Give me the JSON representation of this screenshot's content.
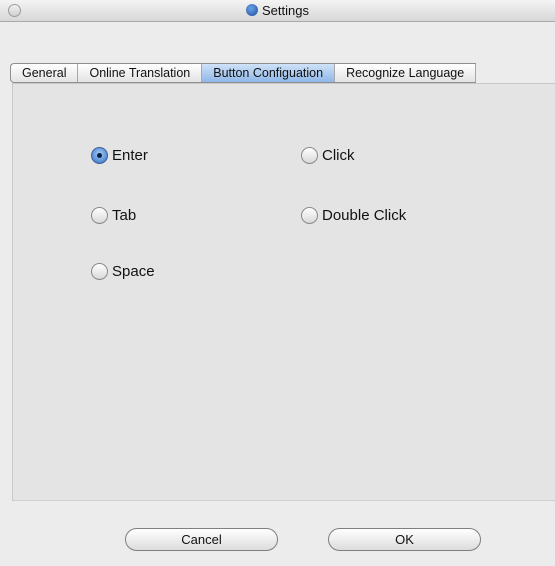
{
  "window": {
    "title": "Settings"
  },
  "tabs": [
    {
      "label": "General"
    },
    {
      "label": "Online Translation"
    },
    {
      "label": "Button Configuation"
    },
    {
      "label": "Recognize Language"
    }
  ],
  "selected_tab": "Button Configuation",
  "options": {
    "enter": {
      "label": "Enter",
      "checked": true
    },
    "tab": {
      "label": "Tab",
      "checked": false
    },
    "space": {
      "label": "Space",
      "checked": false
    },
    "click": {
      "label": "Click",
      "checked": false
    },
    "double_click": {
      "label": "Double Click",
      "checked": false
    }
  },
  "buttons": {
    "cancel": "Cancel",
    "ok": "OK"
  },
  "colors": {
    "selected_tab": "#9fc2ee",
    "radio_checked": "#2f6fcb",
    "window_bg": "#ececec"
  }
}
